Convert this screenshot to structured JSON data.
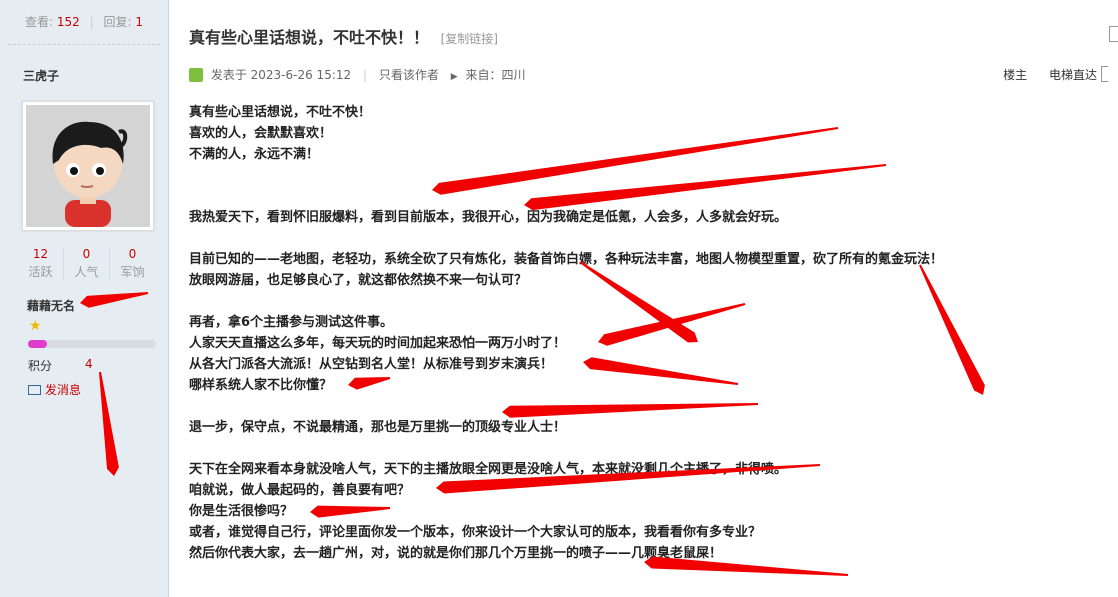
{
  "sidebar": {
    "views_label": "查看:",
    "views": "152",
    "replies_label": "回复:",
    "replies": "1",
    "author": "三虎子",
    "counts": [
      {
        "value": "12",
        "label": "活跃"
      },
      {
        "value": "0",
        "label": "人气"
      },
      {
        "value": "0",
        "label": "军饷"
      }
    ],
    "rank": "藉藉无名",
    "rank_icon": "star-icon",
    "progress_pct": 15,
    "score_label": "积分",
    "score": "4",
    "message": "发消息"
  },
  "post": {
    "title": "真有些心里话想说，不吐不快！！",
    "copy_link": "[复制链接]",
    "posted": "发表于 2023-6-26 15:12",
    "only_author": "只看该作者",
    "source": "来自：四川",
    "floor": "楼主",
    "elevator": "电梯直达",
    "lines": [
      "真有些心里话想说，不吐不快！",
      "喜欢的人，会默默喜欢！",
      "不满的人，永远不满！",
      "",
      "",
      "我热爱天下，看到怀旧服爆料，看到目前版本，我很开心，因为我确定是低氪，人会多，人多就会好玩。",
      "",
      "目前已知的——老地图，老轻功，系统全砍了只有炼化，装备首饰白嫖，各种玩法丰富，地图人物模型重置，砍了所有的氪金玩法！",
      "放眼网游届，也足够良心了，就这都依然换不来一句认可？",
      "",
      "再者，拿6个主播参与测试这件事。",
      "人家天天直播这么多年，每天玩的时间加起来恐怕一两万小时了！",
      "从各大门派各大流派！从空钻到名人堂！从标准号到岁末演兵！",
      "哪样系统人家不比你懂？",
      "",
      "退一步，保守点，不说最精通，那也是万里挑一的顶级专业人士！",
      "",
      "天下在全网来看本身就没啥人气，天下的主播放眼全网更是没啥人气，本来就没剩几个主播了，非得喷。",
      "咱就说，做人最起码的，善良要有吧？",
      "你是生活很惨吗？",
      "或者，谁觉得自己行，评论里面你发一个版本，你来设计一个大家认可的版本，我看看你有多专业？",
      "然后你代表大家，去一趟广州，对，说的就是你们那几个万里挑一的喷子——几颗臭老鼠屎！"
    ]
  },
  "colors": {
    "arrow": "#f00000",
    "accent": "#c00000"
  }
}
